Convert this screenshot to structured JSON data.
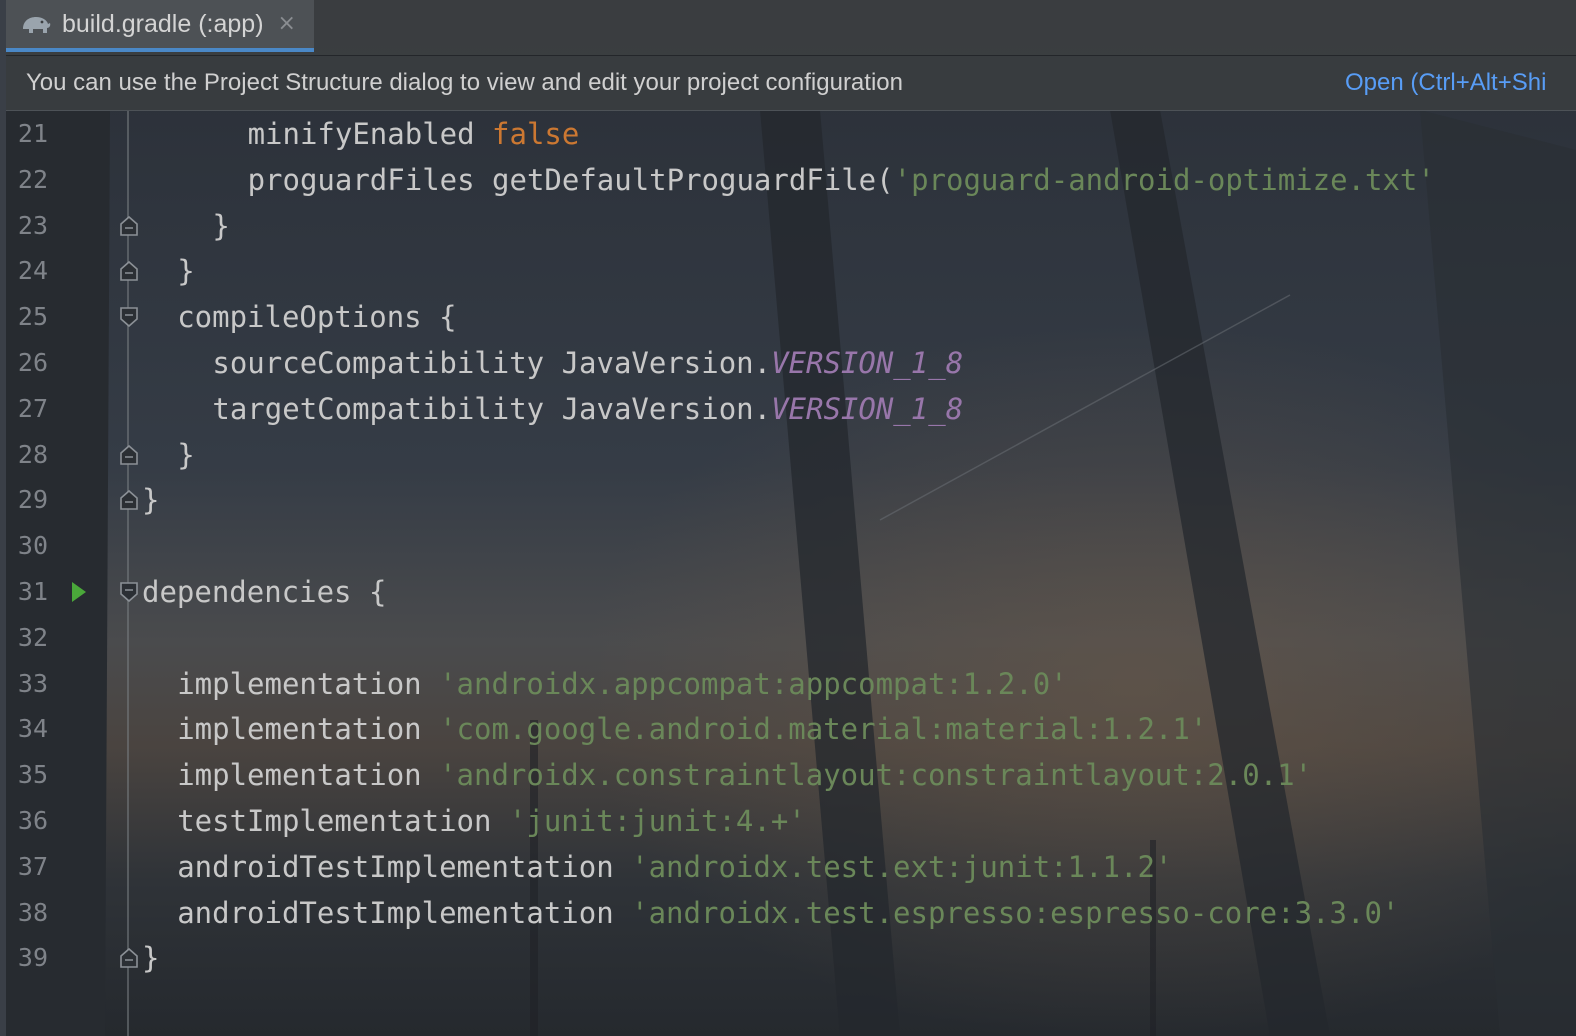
{
  "tab": {
    "icon": "gradle-elephant-icon",
    "title": "build.gradle (:app)",
    "close_glyph": "×"
  },
  "banner": {
    "message": "You can use the Project Structure dialog to view and edit your project configuration",
    "link": "Open (Ctrl+Alt+Shi"
  },
  "editor": {
    "lines": [
      {
        "num": "21",
        "indent": 6,
        "fold": null,
        "run": false,
        "tokens": [
          {
            "t": "minifyEnabled ",
            "c": "plain"
          },
          {
            "t": "false",
            "c": "kw"
          }
        ]
      },
      {
        "num": "22",
        "indent": 6,
        "fold": null,
        "run": false,
        "tokens": [
          {
            "t": "proguardFiles getDefaultProguardFile(",
            "c": "plain"
          },
          {
            "t": "'proguard-android-optimize.txt'",
            "c": "str"
          }
        ]
      },
      {
        "num": "23",
        "indent": 4,
        "fold": "end",
        "run": false,
        "tokens": [
          {
            "t": "}",
            "c": "plain"
          }
        ]
      },
      {
        "num": "24",
        "indent": 2,
        "fold": "end",
        "run": false,
        "tokens": [
          {
            "t": "}",
            "c": "plain"
          }
        ]
      },
      {
        "num": "25",
        "indent": 2,
        "fold": "start",
        "run": false,
        "tokens": [
          {
            "t": "compileOptions {",
            "c": "plain"
          }
        ]
      },
      {
        "num": "26",
        "indent": 4,
        "fold": null,
        "run": false,
        "tokens": [
          {
            "t": "sourceCompatibility JavaVersion.",
            "c": "plain"
          },
          {
            "t": "VERSION_1_8",
            "c": "fld"
          }
        ]
      },
      {
        "num": "27",
        "indent": 4,
        "fold": null,
        "run": false,
        "tokens": [
          {
            "t": "targetCompatibility JavaVersion.",
            "c": "plain"
          },
          {
            "t": "VERSION_1_8",
            "c": "fld"
          }
        ]
      },
      {
        "num": "28",
        "indent": 2,
        "fold": "end",
        "run": false,
        "tokens": [
          {
            "t": "}",
            "c": "plain"
          }
        ]
      },
      {
        "num": "29",
        "indent": 0,
        "fold": "end",
        "run": false,
        "tokens": [
          {
            "t": "}",
            "c": "plain"
          }
        ]
      },
      {
        "num": "30",
        "indent": 0,
        "fold": null,
        "run": false,
        "tokens": []
      },
      {
        "num": "31",
        "indent": 0,
        "fold": "start",
        "run": true,
        "tokens": [
          {
            "t": "dependencies {",
            "c": "plain"
          }
        ]
      },
      {
        "num": "32",
        "indent": 0,
        "fold": null,
        "run": false,
        "tokens": []
      },
      {
        "num": "33",
        "indent": 2,
        "fold": null,
        "run": false,
        "tokens": [
          {
            "t": "implementation ",
            "c": "plain"
          },
          {
            "t": "'androidx.appcompat:appcompat:1.2.0'",
            "c": "str"
          }
        ]
      },
      {
        "num": "34",
        "indent": 2,
        "fold": null,
        "run": false,
        "tokens": [
          {
            "t": "implementation ",
            "c": "plain"
          },
          {
            "t": "'com.google.android.material:material:1.2.1'",
            "c": "str"
          }
        ]
      },
      {
        "num": "35",
        "indent": 2,
        "fold": null,
        "run": false,
        "tokens": [
          {
            "t": "implementation ",
            "c": "plain"
          },
          {
            "t": "'androidx.constraintlayout:constraintlayout:2.0.1'",
            "c": "str"
          }
        ]
      },
      {
        "num": "36",
        "indent": 2,
        "fold": null,
        "run": false,
        "tokens": [
          {
            "t": "testImplementation ",
            "c": "plain"
          },
          {
            "t": "'junit:junit:4.+'",
            "c": "str"
          }
        ]
      },
      {
        "num": "37",
        "indent": 2,
        "fold": null,
        "run": false,
        "tokens": [
          {
            "t": "androidTestImplementation ",
            "c": "plain"
          },
          {
            "t": "'androidx.test.ext:junit:1.1.2'",
            "c": "str"
          }
        ]
      },
      {
        "num": "38",
        "indent": 2,
        "fold": null,
        "run": false,
        "tokens": [
          {
            "t": "androidTestImplementation ",
            "c": "plain"
          },
          {
            "t": "'androidx.test.espresso:espresso-core:3.3.0'",
            "c": "str"
          }
        ]
      },
      {
        "num": "39",
        "indent": 0,
        "fold": "end",
        "run": false,
        "tokens": [
          {
            "t": "}",
            "c": "plain"
          }
        ]
      }
    ]
  },
  "colors": {
    "keyword": "#cc7832",
    "string": "#6a8759",
    "field": "#9876aa",
    "link": "#589df6",
    "tab_underline": "#4a88c7",
    "run_icon": "#4aa83a"
  }
}
